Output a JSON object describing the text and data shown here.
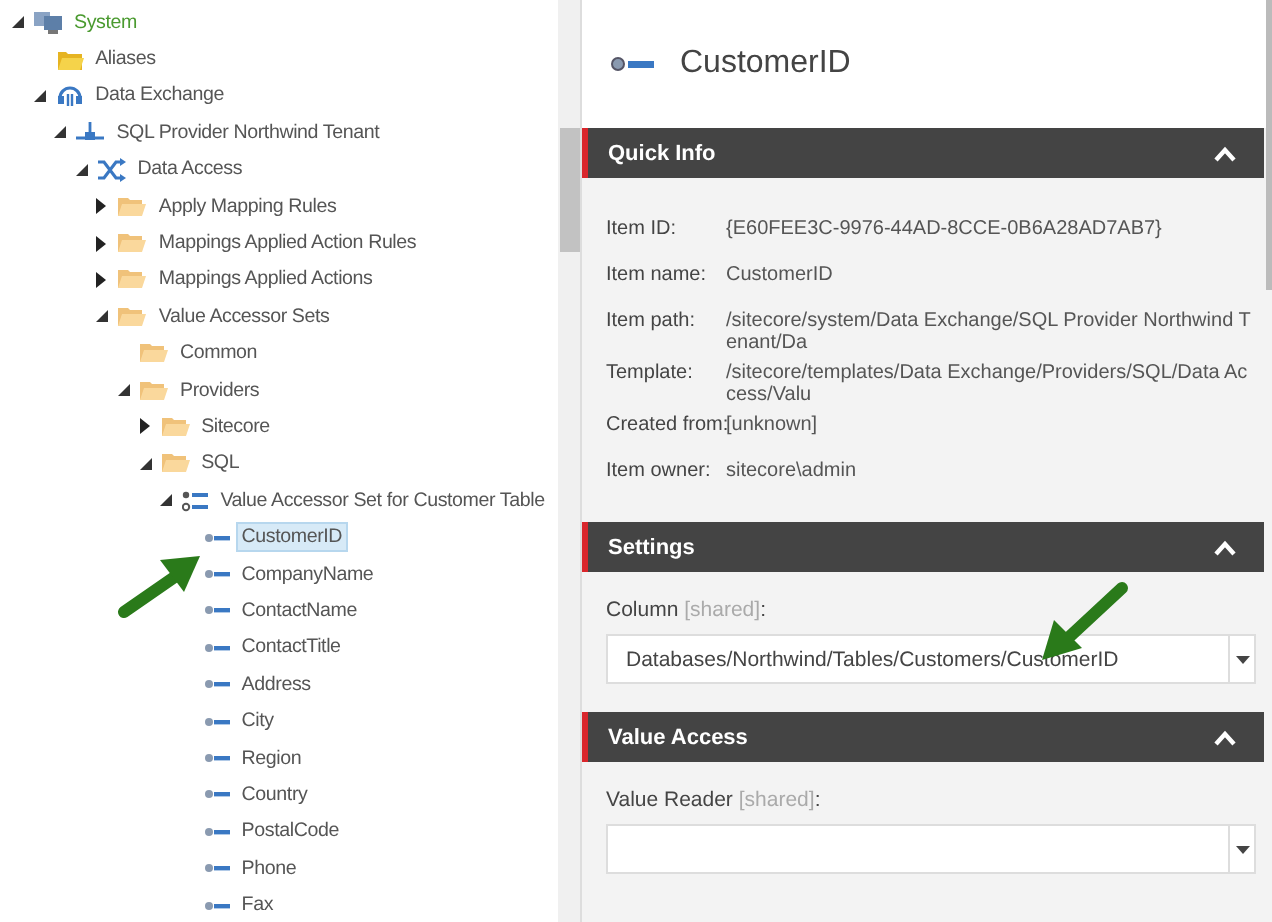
{
  "tree": [
    {
      "label": "System",
      "kind": "system",
      "color": "#4a9a2f",
      "expanded": true,
      "selected": false,
      "children": [
        {
          "label": "Aliases",
          "kind": "alias",
          "selected": false
        },
        {
          "label": "Data Exchange",
          "kind": "exchange",
          "expanded": true,
          "selected": false,
          "children": [
            {
              "label": "SQL Provider Northwind Tenant",
              "kind": "tenant",
              "expanded": true,
              "selected": false,
              "children": [
                {
                  "label": "Data Access",
                  "kind": "shuffle",
                  "expanded": true,
                  "selected": false,
                  "children": [
                    {
                      "label": "Apply Mapping Rules",
                      "kind": "folder",
                      "expanded": false,
                      "selected": false
                    },
                    {
                      "label": "Mappings Applied Action Rules",
                      "kind": "folder",
                      "expanded": false,
                      "selected": false
                    },
                    {
                      "label": "Mappings Applied Actions",
                      "kind": "folder",
                      "expanded": false,
                      "selected": false
                    },
                    {
                      "label": "Value Accessor Sets",
                      "kind": "folder",
                      "expanded": true,
                      "selected": false,
                      "children": [
                        {
                          "label": "Common",
                          "kind": "folder",
                          "selected": false
                        },
                        {
                          "label": "Providers",
                          "kind": "folder",
                          "expanded": true,
                          "selected": false,
                          "children": [
                            {
                              "label": "Sitecore",
                              "kind": "folder",
                              "expanded": false,
                              "selected": false
                            },
                            {
                              "label": "SQL",
                              "kind": "folder",
                              "expanded": true,
                              "selected": false,
                              "children": [
                                {
                                  "label": "Value Accessor Set for Customer Table",
                                  "kind": "list",
                                  "expanded": true,
                                  "selected": false,
                                  "children": [
                                    {
                                      "label": "CustomerID",
                                      "kind": "field",
                                      "selected": true
                                    },
                                    {
                                      "label": "CompanyName",
                                      "kind": "field",
                                      "selected": false
                                    },
                                    {
                                      "label": "ContactName",
                                      "kind": "field",
                                      "selected": false
                                    },
                                    {
                                      "label": "ContactTitle",
                                      "kind": "field",
                                      "selected": false
                                    },
                                    {
                                      "label": "Address",
                                      "kind": "field",
                                      "selected": false
                                    },
                                    {
                                      "label": "City",
                                      "kind": "field",
                                      "selected": false
                                    },
                                    {
                                      "label": "Region",
                                      "kind": "field",
                                      "selected": false
                                    },
                                    {
                                      "label": "Country",
                                      "kind": "field",
                                      "selected": false
                                    },
                                    {
                                      "label": "PostalCode",
                                      "kind": "field",
                                      "selected": false
                                    },
                                    {
                                      "label": "Phone",
                                      "kind": "field",
                                      "selected": false
                                    },
                                    {
                                      "label": "Fax",
                                      "kind": "field",
                                      "selected": false
                                    }
                                  ]
                                }
                              ]
                            }
                          ]
                        }
                      ]
                    }
                  ]
                }
              ]
            }
          ]
        }
      ]
    }
  ],
  "item_header": {
    "title": "CustomerID"
  },
  "sections": [
    {
      "title": "Quick Info",
      "kind": "info",
      "expanded": true,
      "fields": [
        {
          "label": "Item ID:",
          "value": "{E60FEE3C-9976-44AD-8CCE-0B6A28AD7AB7}"
        },
        {
          "label": "Item name:",
          "value": "CustomerID"
        },
        {
          "label": "Item path:",
          "value": "/sitecore/system/Data Exchange/SQL Provider Northwind Tenant/Da"
        },
        {
          "label": "Template:",
          "value": "/sitecore/templates/Data Exchange/Providers/SQL/Data Access/Valu"
        },
        {
          "label": "Created from:",
          "value": "[unknown]"
        },
        {
          "label": "Item owner:",
          "value": "sitecore\\admin"
        }
      ]
    },
    {
      "title": "Settings",
      "kind": "form",
      "expanded": true,
      "fields": [
        {
          "label": "Column",
          "tag": "[shared]",
          "end": ":",
          "value": "Databases/Northwind/Tables/Customers/CustomerID"
        }
      ]
    },
    {
      "title": "Value Access",
      "kind": "form",
      "expanded": true,
      "fields": [
        {
          "label": "Value Reader",
          "tag": "[shared]",
          "end": ":"
        }
      ]
    }
  ]
}
